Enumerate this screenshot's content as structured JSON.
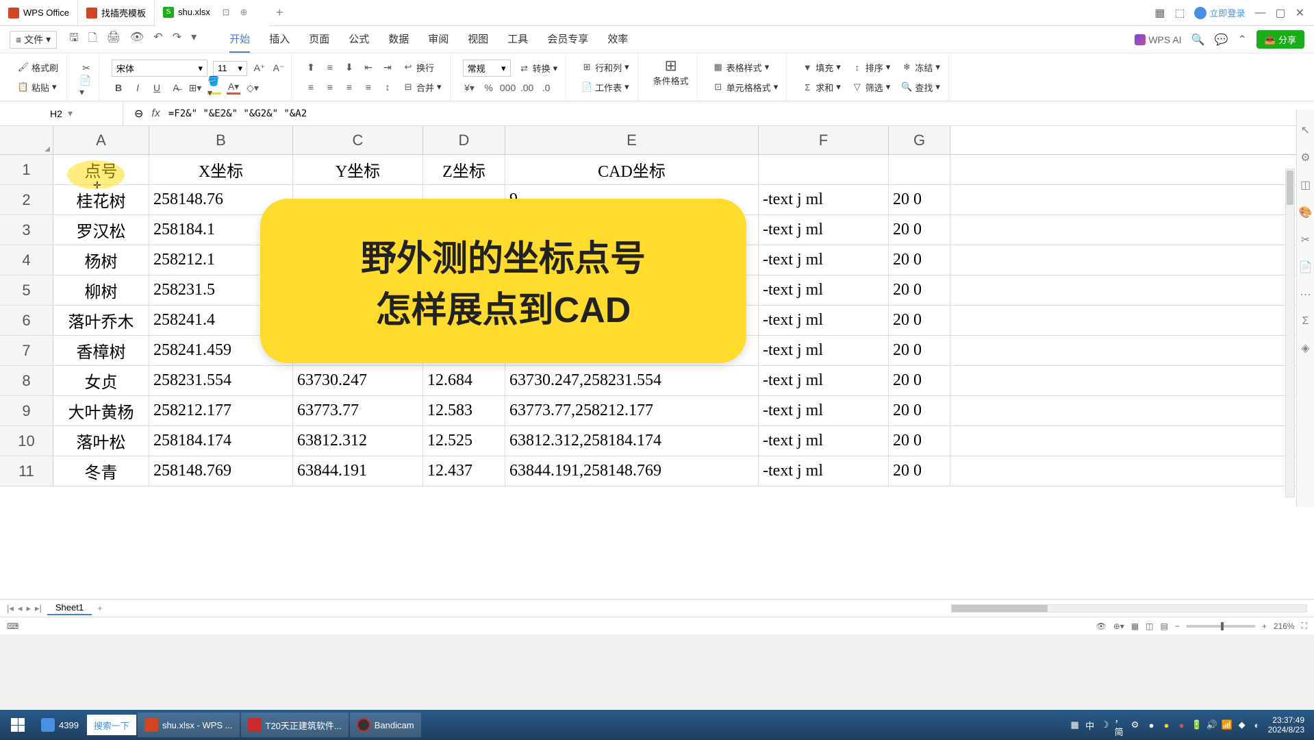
{
  "titlebar": {
    "app_name": "WPS Office",
    "template_tab": "找插壳模板",
    "file_tab": "shu.xlsx",
    "login": "立即登录"
  },
  "menubar": {
    "file": "文件",
    "tabs": [
      "开始",
      "插入",
      "页面",
      "公式",
      "数据",
      "审阅",
      "视图",
      "工具",
      "会员专享",
      "效率"
    ],
    "active_tab": 0,
    "wps_ai": "WPS AI",
    "share": "分享"
  },
  "ribbon": {
    "format_brush": "格式刷",
    "paste": "粘贴",
    "font_name": "宋体",
    "font_size": "11",
    "wrap": "换行",
    "merge": "合并",
    "general": "常规",
    "convert": "转换",
    "rowcol": "行和列",
    "worksheet": "工作表",
    "cond_fmt": "条件格式",
    "table_style": "表格样式",
    "cell_fmt": "单元格格式",
    "fill": "填充",
    "sort": "排序",
    "freeze": "冻结",
    "sum": "求和",
    "filter": "筛选",
    "find": "查找"
  },
  "formula": {
    "cell_ref": "H2",
    "content": "=F2&\" \"&E2&\" \"&G2&\" \"&A2"
  },
  "columns": [
    "A",
    "B",
    "C",
    "D",
    "E",
    "F",
    "G"
  ],
  "headers": {
    "A": "点号",
    "B": "X坐标",
    "C": "Y坐标",
    "D": "Z坐标",
    "E": "CAD坐标"
  },
  "rows": [
    {
      "n": "1",
      "A": "点号",
      "B": "X坐标",
      "C": "Y坐标",
      "D": "Z坐标",
      "E": "CAD坐标",
      "F": "",
      "G": ""
    },
    {
      "n": "2",
      "A": "桂花树",
      "B": "258148.76",
      "C": "",
      "D": "",
      "E": "9",
      "F": "-text j ml",
      "G": "20 0"
    },
    {
      "n": "3",
      "A": "罗汉松",
      "B": "258184.1",
      "C": "",
      "D": "",
      "E": "",
      "F": "-text j ml",
      "G": "20 0"
    },
    {
      "n": "4",
      "A": "杨树",
      "B": "258212.1",
      "C": "",
      "D": "",
      "E": "",
      "F": "-text j ml",
      "G": "20 0"
    },
    {
      "n": "5",
      "A": "柳树",
      "B": "258231.5",
      "C": "",
      "D": "",
      "E": "",
      "F": "-text j ml",
      "G": "20 0"
    },
    {
      "n": "6",
      "A": "落叶乔木",
      "B": "258241.4",
      "C": "",
      "D": "",
      "E": ")",
      "F": "-text j ml",
      "G": "20 0"
    },
    {
      "n": "7",
      "A": "香樟树",
      "B": "258241.459",
      "C": "63683.647",
      "D": "12.472",
      "E": "63683.647,258241.459",
      "F": "-text j ml",
      "G": "20 0"
    },
    {
      "n": "8",
      "A": "女贞",
      "B": "258231.554",
      "C": "63730.247",
      "D": "12.684",
      "E": "63730.247,258231.554",
      "F": "-text j ml",
      "G": "20 0"
    },
    {
      "n": "9",
      "A": "大叶黄杨",
      "B": "258212.177",
      "C": "63773.77",
      "D": "12.583",
      "E": "63773.77,258212.177",
      "F": "-text j ml",
      "G": "20 0"
    },
    {
      "n": "10",
      "A": "落叶松",
      "B": "258184.174",
      "C": "63812.312",
      "D": "12.525",
      "E": "63812.312,258184.174",
      "F": "-text j ml",
      "G": "20 0"
    },
    {
      "n": "11",
      "A": "冬青",
      "B": "258148.769",
      "C": "63844.191",
      "D": "12.437",
      "E": "63844.191,258148.769",
      "F": "-text j ml",
      "G": "20 0"
    }
  ],
  "overlay": {
    "line1": "野外测的坐标点号",
    "line2": "怎样展点到CAD"
  },
  "sheet": {
    "name": "Sheet1"
  },
  "status": {
    "zoom": "216%"
  },
  "taskbar": {
    "app1": "4399",
    "search": "搜索一下",
    "wps": "shu.xlsx - WPS ...",
    "cad": "T20天正建筑软件...",
    "bandicam": "Bandicam",
    "ime": "中",
    "time": "23:37:49",
    "date": "2024/8/23"
  }
}
